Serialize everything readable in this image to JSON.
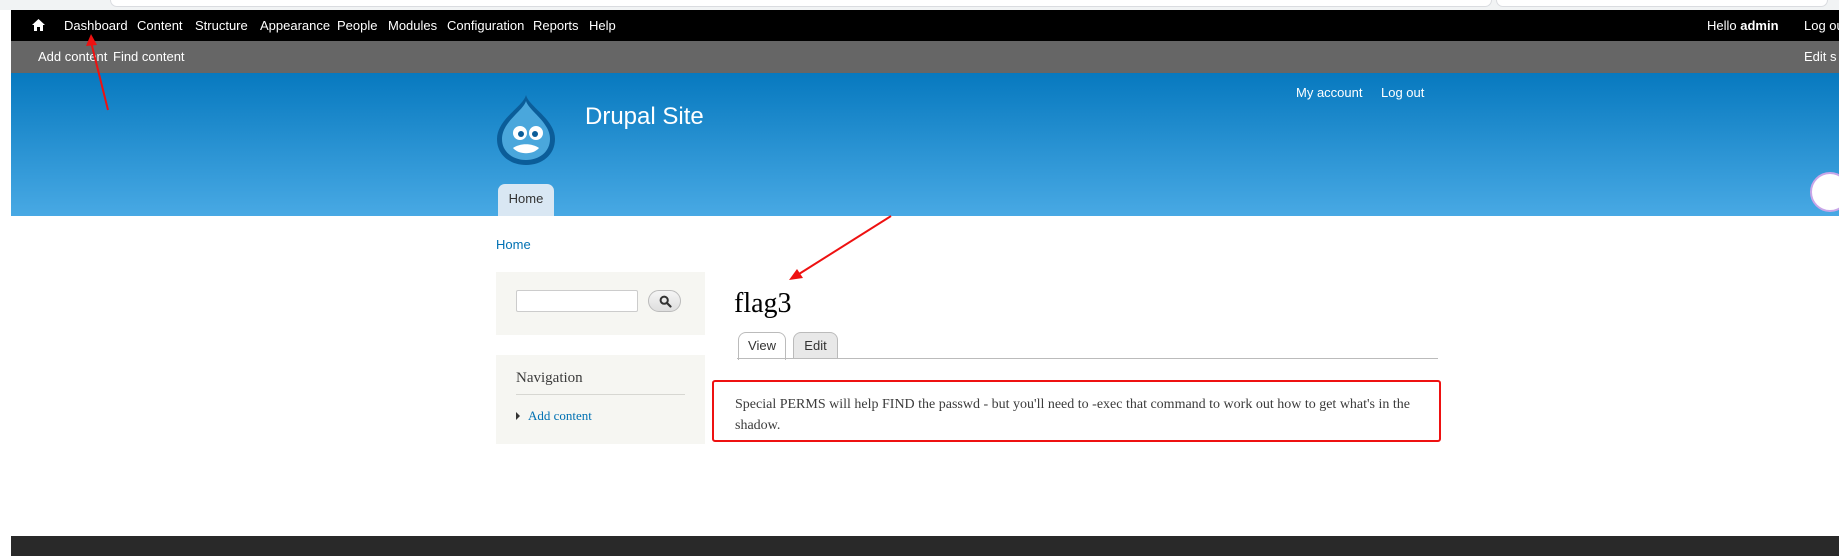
{
  "toolbar": {
    "items": [
      "Dashboard",
      "Content",
      "Structure",
      "Appearance",
      "People",
      "Modules",
      "Configuration",
      "Reports",
      "Help"
    ],
    "greeting": "Hello ",
    "user": "admin",
    "logout": "Log ou"
  },
  "shortcuts": {
    "items": [
      "Add content",
      "Find content"
    ],
    "edit": "Edit s"
  },
  "header": {
    "site_name": "Drupal Site",
    "secondary_links": [
      "My account",
      "Log out"
    ],
    "main_tab": "Home",
    "logo_icon": "drupal-drop-icon"
  },
  "breadcrumb": "Home",
  "search": {
    "placeholder": "",
    "button_icon": "magnifier-icon"
  },
  "navigation": {
    "title": "Navigation",
    "items": [
      "Add content"
    ]
  },
  "node": {
    "title": "flag3",
    "tabs": [
      "View",
      "Edit"
    ],
    "body": "Special PERMS will help FIND the passwd - but you'll need to -exec that command to work out how to get what's in the shadow."
  },
  "colors": {
    "toolbar": "#000000",
    "shortcut_bar": "#666666",
    "header_top": "#0779bf",
    "header_bottom": "#48a9e4",
    "link": "#0071b3",
    "annotation": "#ee1111"
  }
}
